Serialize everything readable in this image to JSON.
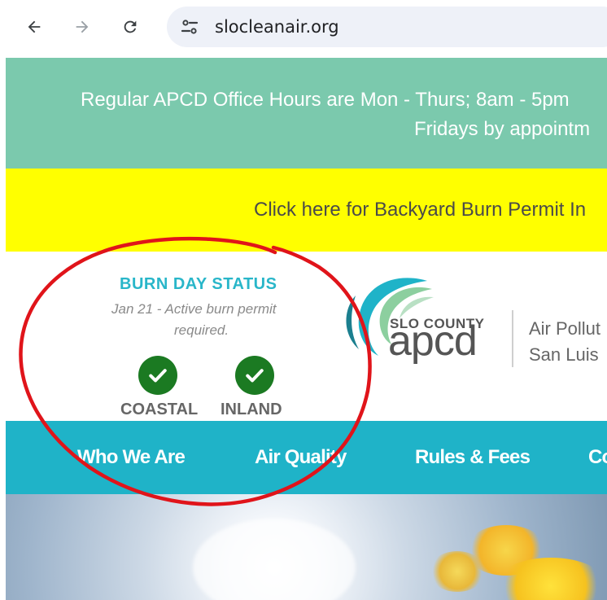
{
  "browser": {
    "url": "slocleanair.org"
  },
  "banners": {
    "hours_line1": "Regular APCD Office Hours are Mon - Thurs; 8am - 5pm",
    "hours_line2": "Fridays by appointm",
    "burn_permit_link": "Click here for Backyard Burn Permit In"
  },
  "burn_status": {
    "title": "BURN DAY STATUS",
    "subtitle_line1": "Jan 21 - Active burn permit",
    "subtitle_line2": "required.",
    "zones": [
      {
        "label": "COASTAL",
        "status_icon": "check-icon",
        "color": "#1b7a22"
      },
      {
        "label": "INLAND",
        "status_icon": "check-icon",
        "color": "#1b7a22"
      }
    ]
  },
  "logo": {
    "county": "SLO COUNTY",
    "name": "apcd",
    "tagline_line1": "Air Pollut",
    "tagline_line2": "San Luis"
  },
  "nav": {
    "items": [
      "Who We Are",
      "Air Quality",
      "Rules & Fees",
      "Co"
    ]
  },
  "colors": {
    "hours_banner": "#7bc9ad",
    "burn_banner": "#ffff00",
    "navbar": "#1fb3c8",
    "status_title": "#29b6c9",
    "annotation_circle": "#e0141a"
  }
}
